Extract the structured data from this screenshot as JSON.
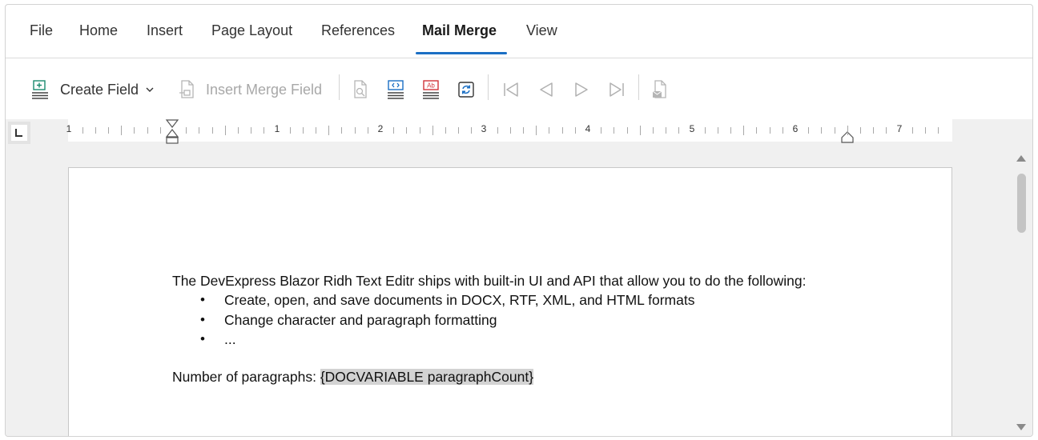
{
  "tabs": [
    {
      "label": "File",
      "active": false
    },
    {
      "label": "Home",
      "active": false
    },
    {
      "label": "Insert",
      "active": false
    },
    {
      "label": "Page Layout",
      "active": false
    },
    {
      "label": "References",
      "active": false
    },
    {
      "label": "Mail Merge",
      "active": true
    },
    {
      "label": "View",
      "active": false
    }
  ],
  "toolbar": {
    "create_field_label": "Create Field",
    "insert_merge_field_label": "Insert Merge Field"
  },
  "ruler": {
    "numbers": [
      "1",
      "1",
      "2",
      "3",
      "4",
      "5",
      "6",
      "7"
    ]
  },
  "document": {
    "intro": "The DevExpress Blazor Ridh Text Editr ships with built-in UI and API that allow you to do the following:",
    "bullets": [
      "Create, open, and save documents in DOCX, RTF, XML, and HTML formats",
      "Change character and paragraph formatting",
      "..."
    ],
    "count_label": "Number of paragraphs: ",
    "field_code": "{DOCVARIABLE paragraphCount}"
  },
  "colors": {
    "accent": "#1b6fc4",
    "icon_teal": "#1a8a6e",
    "icon_red": "#d13438",
    "icon_blue": "#1b6fc4"
  }
}
